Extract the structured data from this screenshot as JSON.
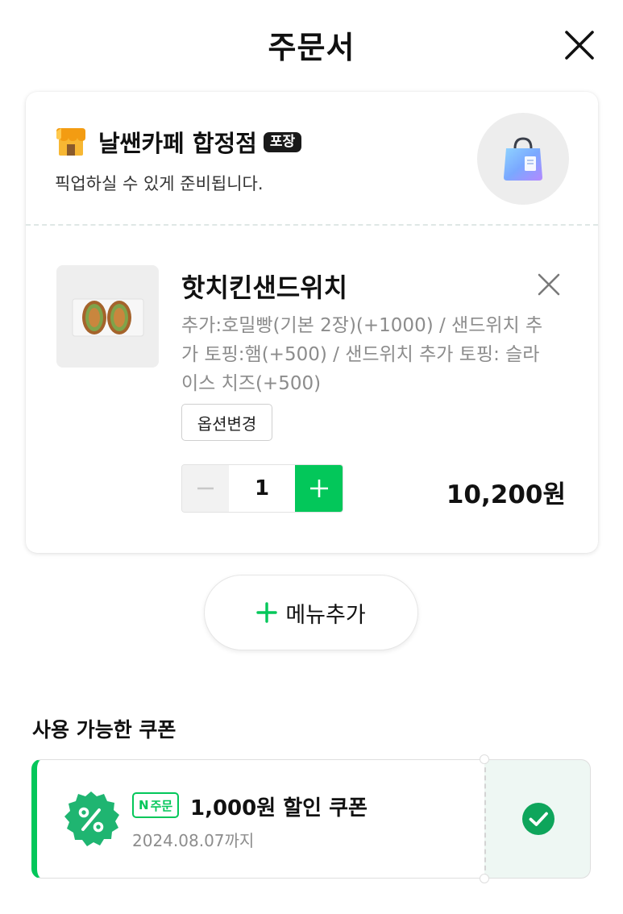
{
  "header": {
    "title": "주문서",
    "close_icon": "close-icon"
  },
  "store": {
    "name": "날쌘카페 합정점",
    "badge": "포장",
    "subtitle": "픽업하실 수 있게 준비됩니다.",
    "store_icon": "store-icon",
    "bag_icon": "shopping-bag-icon"
  },
  "item": {
    "name": "핫치킨샌드위치",
    "options": "추가:호밀빵(기본 2장)(+1000) / 샌드위치 추가 토핑:햄(+500) / 샌드위치 추가 토핑: 슬라이스 치즈(+500)",
    "option_change_label": "옵션변경",
    "quantity": "1",
    "price": "10,200원"
  },
  "add_menu": {
    "label": "메뉴추가"
  },
  "coupons": {
    "heading": "사용 가능한 쿠폰",
    "items": [
      {
        "tag": "주문",
        "tag_prefix": "N",
        "title": "1,000원 할인 쿠폰",
        "expiry": "2024.08.07까지",
        "selected": true
      }
    ]
  },
  "colors": {
    "accent": "#03c75a",
    "text_primary": "#111111",
    "text_muted": "#8c8c8c"
  }
}
